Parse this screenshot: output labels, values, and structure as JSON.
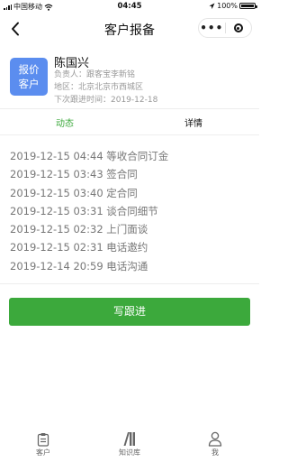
{
  "status_bar": {
    "carrier": "中国移动",
    "time": "04:45",
    "battery": "100%",
    "wifi_icon": "wifi-icon",
    "battery_icon": "battery-icon"
  },
  "nav": {
    "title": "客户报备",
    "more": "•••",
    "back_icon": "chevron-left-icon",
    "close_icon": "target-icon"
  },
  "customer": {
    "badge_line1": "报价",
    "badge_line2": "客户",
    "badge_color": "#5b8def",
    "name": "陈国兴",
    "owner": "负责人：跟客宝李新铭",
    "region": "地区：北京北京市西城区",
    "next_follow": "下次跟进时间：2019-12-18"
  },
  "tabs": [
    {
      "label": "动态",
      "active": true
    },
    {
      "label": "详情",
      "active": false
    }
  ],
  "accent_color": "#3ca93c",
  "timeline": [
    "2019-12-15 04:44 等收合同订金",
    "2019-12-15 03:43 签合同",
    "2019-12-15 03:40 定合同",
    "2019-12-15 03:31 谈合同细节",
    "2019-12-15 02:32 上门面谈",
    "2019-12-15 02:31 电话邀约",
    "2019-12-14 20:59 电话沟通"
  ],
  "write_button": "写跟进",
  "tabbar": [
    {
      "label": "客户",
      "icon": "clipboard-icon"
    },
    {
      "label": "知识库",
      "icon": "books-icon"
    },
    {
      "label": "我",
      "icon": "person-icon"
    }
  ]
}
